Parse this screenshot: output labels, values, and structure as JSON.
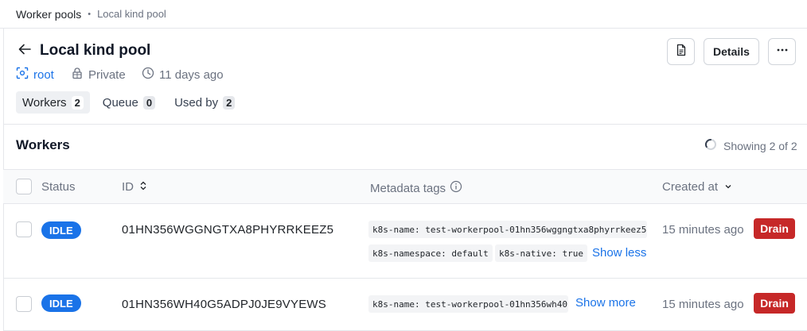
{
  "breadcrumb": {
    "parent": "Worker pools",
    "separator": "•",
    "current": "Local kind pool"
  },
  "header": {
    "title": "Local kind pool",
    "space": "root",
    "visibility": "Private",
    "created": "11 days ago",
    "details_label": "Details"
  },
  "tabs": [
    {
      "label": "Workers",
      "count": "2",
      "active": true
    },
    {
      "label": "Queue",
      "count": "0",
      "active": false
    },
    {
      "label": "Used by",
      "count": "2",
      "active": false
    }
  ],
  "workers_section": {
    "title": "Workers",
    "showing": "Showing 2 of 2"
  },
  "table": {
    "columns": {
      "status": "Status",
      "id": "ID",
      "tags": "Metadata tags",
      "created": "Created at"
    },
    "rows": [
      {
        "status": "IDLE",
        "id": "01HN356WGGNGTXA8PHYRRKEEZ5",
        "tags": [
          "k8s-name: test-workerpool-01hn356wggngtxa8phyrrkeez5",
          "k8s-namespace: default",
          "k8s-native: true"
        ],
        "toggle": "Show less",
        "created": "15 minutes ago",
        "action": "Drain"
      },
      {
        "status": "IDLE",
        "id": "01HN356WH40G5ADPJ0JE9VYEWS",
        "tags": [
          "k8s-name: test-workerpool-01hn356wh40"
        ],
        "toggle": "Show more",
        "created": "15 minutes ago",
        "action": "Drain"
      }
    ]
  },
  "colors": {
    "accent": "#1a73e8",
    "danger": "#c62828",
    "muted": "#6b7280"
  },
  "icons": [
    "arrow-left-icon",
    "space-icon",
    "lock-icon",
    "clock-icon",
    "document-icon",
    "more-icon",
    "spinner-icon",
    "sort-icon",
    "sort-down-icon",
    "info-icon"
  ]
}
